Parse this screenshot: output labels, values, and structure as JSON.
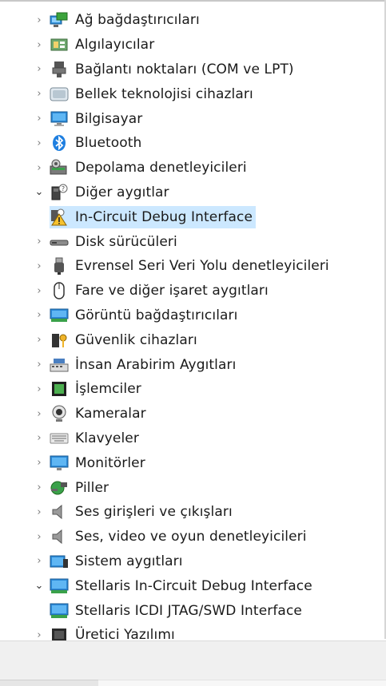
{
  "tree": {
    "items": [
      {
        "label": "Ağ bağdaştırıcıları",
        "icon": "network-adapter-icon",
        "expanded": false,
        "level": 0
      },
      {
        "label": "Algılayıcılar",
        "icon": "sensor-icon",
        "expanded": false,
        "level": 0
      },
      {
        "label": "Bağlantı noktaları (COM ve LPT)",
        "icon": "port-icon",
        "expanded": false,
        "level": 0
      },
      {
        "label": "Bellek teknolojisi cihazları",
        "icon": "memory-device-icon",
        "expanded": false,
        "level": 0
      },
      {
        "label": "Bilgisayar",
        "icon": "computer-icon",
        "expanded": false,
        "level": 0
      },
      {
        "label": "Bluetooth",
        "icon": "bluetooth-icon",
        "expanded": false,
        "level": 0
      },
      {
        "label": "Depolama denetleyicileri",
        "icon": "storage-controller-icon",
        "expanded": false,
        "level": 0
      },
      {
        "label": "Diğer aygıtlar",
        "icon": "unknown-device-icon",
        "expanded": true,
        "level": 0
      },
      {
        "label": "In-Circuit Debug Interface",
        "icon": "warning-device-icon",
        "level": 1,
        "selected": true
      },
      {
        "label": "Disk sürücüleri",
        "icon": "disk-drive-icon",
        "expanded": false,
        "level": 0
      },
      {
        "label": "Evrensel Seri Veri Yolu denetleyicileri",
        "icon": "usb-icon",
        "expanded": false,
        "level": 0
      },
      {
        "label": "Fare ve diğer işaret aygıtları",
        "icon": "mouse-icon",
        "expanded": false,
        "level": 0
      },
      {
        "label": "Görüntü bağdaştırıcıları",
        "icon": "display-adapter-icon",
        "expanded": false,
        "level": 0
      },
      {
        "label": "Güvenlik cihazları",
        "icon": "security-device-icon",
        "expanded": false,
        "level": 0
      },
      {
        "label": "İnsan Arabirim Aygıtları",
        "icon": "hid-icon",
        "expanded": false,
        "level": 0
      },
      {
        "label": "İşlemciler",
        "icon": "processor-icon",
        "expanded": false,
        "level": 0
      },
      {
        "label": "Kameralar",
        "icon": "camera-icon",
        "expanded": false,
        "level": 0
      },
      {
        "label": "Klavyeler",
        "icon": "keyboard-icon",
        "expanded": false,
        "level": 0
      },
      {
        "label": "Monitörler",
        "icon": "monitor-icon",
        "expanded": false,
        "level": 0
      },
      {
        "label": "Piller",
        "icon": "battery-icon",
        "expanded": false,
        "level": 0
      },
      {
        "label": "Ses girişleri ve çıkışları",
        "icon": "speaker-icon",
        "expanded": false,
        "level": 0
      },
      {
        "label": "Ses, video ve oyun denetleyicileri",
        "icon": "speaker-icon",
        "expanded": false,
        "level": 0
      },
      {
        "label": "Sistem aygıtları",
        "icon": "system-device-icon",
        "expanded": false,
        "level": 0
      },
      {
        "label": "Stellaris In-Circuit Debug Interface",
        "icon": "stellaris-icon",
        "expanded": true,
        "level": 0
      },
      {
        "label": "Stellaris ICDI JTAG/SWD Interface",
        "icon": "stellaris-icon",
        "level": 1
      },
      {
        "label": "Üretici Yazılımı",
        "icon": "firmware-icon",
        "expanded": false,
        "level": 0
      }
    ]
  },
  "chevrons": {
    "collapsed": "›",
    "expanded": "⌄"
  },
  "colors": {
    "selection": "#cce8ff",
    "text": "#1a1a1a",
    "chevron": "#7b7b7b"
  }
}
